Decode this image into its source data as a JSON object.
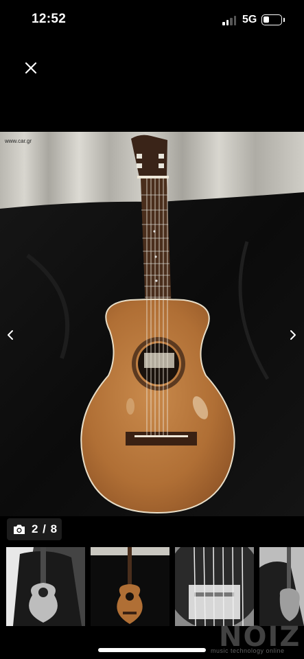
{
  "status_bar": {
    "time": "12:52",
    "network": "5G",
    "battery_level": 0.3,
    "signal_bars": 2
  },
  "viewer": {
    "close_icon": "close-icon",
    "prev_icon": "chevron-left-icon",
    "next_icon": "chevron-right-icon",
    "image_watermark": "www.car.gr",
    "counter": "2 / 8",
    "counter_icon": "camera-icon"
  },
  "thumbnails": [
    {
      "name": "guitar-in-case",
      "style": "grayscale"
    },
    {
      "name": "guitar-full-view",
      "style": "color"
    },
    {
      "name": "guitar-soundhole-label",
      "style": "grayscale"
    },
    {
      "name": "guitar-side-view",
      "style": "grayscale"
    }
  ],
  "footer": {
    "brand": "NOIZ",
    "tagline": "music technology online"
  },
  "colors": {
    "background": "#000000",
    "counter_bg": "#1c1c1c",
    "guitar_top": "#b8773e"
  }
}
